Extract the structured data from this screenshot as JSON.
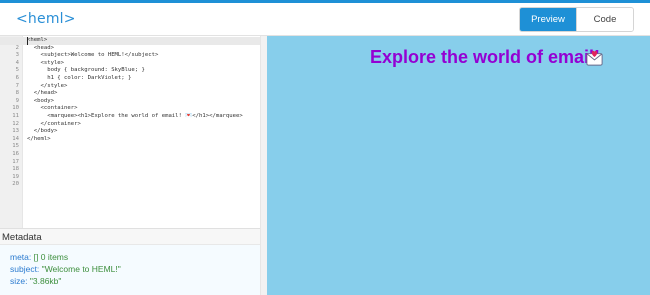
{
  "app": {
    "logo": "<heml>"
  },
  "toolbar": {
    "preview_label": "Preview",
    "code_label": "Code"
  },
  "editor": {
    "line_numbers": [
      "1",
      "2",
      "3",
      "4",
      "5",
      "6",
      "7",
      "8",
      "9",
      "10",
      "11",
      "12",
      "13",
      "14",
      "15",
      "16",
      "17",
      "18",
      "19",
      "20"
    ],
    "lines": [
      "<heml>",
      "  <head>",
      "    <subject>Welcome to HEML!</subject>",
      "    <style>",
      "      body { background: SkyBlue; }",
      "      h1 { color: DarkViolet; }",
      "    </style>",
      "  </head>",
      "  <body>",
      "    <container>",
      "      <marquee><h1>Explore the world of email! 💌</h1></marquee>",
      "    </container>",
      "  </body>",
      "</heml>",
      "",
      "",
      "",
      "",
      "",
      ""
    ]
  },
  "metadata": {
    "title": "Metadata",
    "rows": [
      {
        "key": "meta:",
        "value": "[]  0 items"
      },
      {
        "key": "subject:",
        "value": "\"Welcome to HEML!\""
      },
      {
        "key": "size:",
        "value": "\"3.86kb\""
      }
    ]
  },
  "preview": {
    "heading": "Explore the world of email!",
    "icon": "love-letter-icon",
    "background_color": "#87ceeb",
    "heading_color": "#9400d3"
  }
}
